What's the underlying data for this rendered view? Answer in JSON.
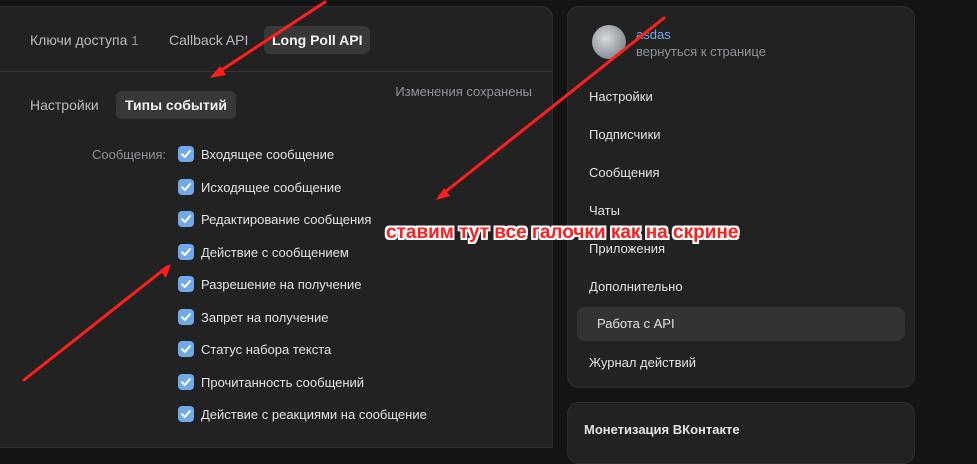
{
  "tabs": {
    "keys_label": "Ключи доступа",
    "keys_count": "1",
    "callback_label": "Callback API",
    "longpoll_label": "Long Poll API"
  },
  "subtabs": {
    "settings_label": "Настройки",
    "events_label": "Типы событий"
  },
  "status": "Изменения сохранены",
  "messages_group": {
    "label": "Сообщения:",
    "items": [
      {
        "label": "Входящее сообщение",
        "checked": true
      },
      {
        "label": "Исходящее сообщение",
        "checked": true
      },
      {
        "label": "Редактирование сообщения",
        "checked": true
      },
      {
        "label": "Действие с сообщением",
        "checked": true
      },
      {
        "label": "Разрешение на получение",
        "checked": true
      },
      {
        "label": "Запрет на получение",
        "checked": true
      },
      {
        "label": "Статус набора текста",
        "checked": true
      },
      {
        "label": "Прочитанность сообщений",
        "checked": true
      },
      {
        "label": "Действие с реакциями на сообщение",
        "checked": true
      }
    ]
  },
  "sidebar": {
    "group_name": "asdas",
    "back_link": "вернуться к странице",
    "items": [
      {
        "label": "Настройки",
        "active": false
      },
      {
        "label": "Подписчики",
        "active": false
      },
      {
        "label": "Сообщения",
        "active": false
      },
      {
        "label": "Чаты",
        "active": false
      },
      {
        "label": "Приложения",
        "active": false
      },
      {
        "label": "Дополнительно",
        "active": false
      },
      {
        "label": "Работа с API",
        "active": true
      },
      {
        "label": "Журнал действий",
        "active": false
      }
    ],
    "second_card_title": "Монетизация ВКонтакте"
  },
  "annotation": {
    "text": "ставим тут все галочки как на скрине",
    "color": "#ff1e1e"
  },
  "colors": {
    "accent": "#71aaeb",
    "background": "#141414",
    "card": "#222222"
  }
}
